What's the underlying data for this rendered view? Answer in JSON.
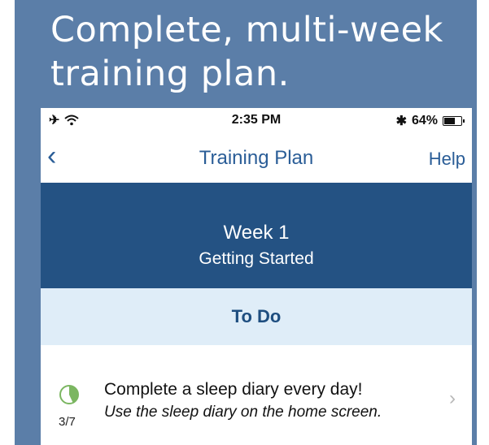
{
  "headline": {
    "line1": "Complete, multi-week",
    "line2": "training plan."
  },
  "status_bar": {
    "time": "2:35 PM",
    "battery_percent": "64%",
    "battery_level": 0.64
  },
  "nav": {
    "title": "Training Plan",
    "help_label": "Help",
    "back_icon": "chevron-left-icon"
  },
  "week": {
    "title": "Week 1",
    "subtitle": "Getting Started"
  },
  "todo": {
    "label": "To Do"
  },
  "task": {
    "title": "Complete a sleep diary every day!",
    "subtitle": "Use the sleep diary on the home screen.",
    "progress": "3/7",
    "progress_fraction": 0.43,
    "progress_color": "#7bb661"
  },
  "colors": {
    "background": "#5b7ea8",
    "accent": "#2a5d97",
    "banner": "#245283",
    "todo_background": "#dfedf8"
  }
}
